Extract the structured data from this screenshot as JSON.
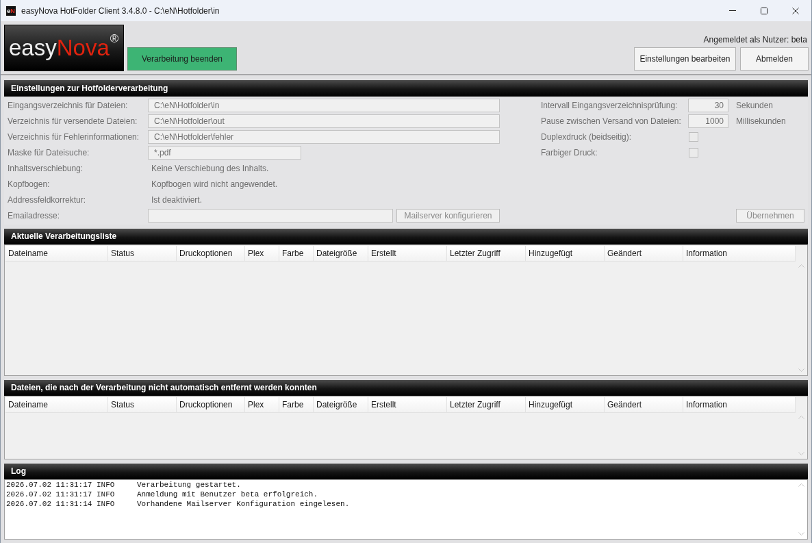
{
  "window": {
    "icon": {
      "first": "e",
      "second": "N"
    },
    "title": "easyNova HotFolder Client 3.4.8.0 - C:\\eN\\Hotfolder\\in"
  },
  "header": {
    "logo": {
      "first": "easy",
      "second": "Nova",
      "mark": "®"
    },
    "primary_button": "Verarbeitung beenden",
    "user_label": "Angemeldet als Nutzer: beta",
    "buttons": [
      "Einstellungen bearbeiten",
      "Abmelden"
    ]
  },
  "settings": {
    "title": "Einstellungen zur Hotfolderverarbeitung",
    "disabled": true,
    "left": [
      {
        "kind": "wide_field",
        "label": "Eingangsverzeichnis für Dateien:",
        "value": "C:\\eN\\Hotfolder\\in"
      },
      {
        "kind": "wide_field",
        "label": "Verzeichnis für versendete Dateien:",
        "value": "C:\\eN\\Hotfolder\\out"
      },
      {
        "kind": "wide_field",
        "label": "Verzeichnis für Fehlerinformationen:",
        "value": "C:\\eN\\Hotfolder\\fehler"
      },
      {
        "kind": "short_field",
        "label": "Maske für Dateisuche:",
        "value": "*.pdf"
      },
      {
        "kind": "text",
        "label": "Inhaltsverschiebung:",
        "value": "Keine Verschiebung des Inhalts."
      },
      {
        "kind": "text",
        "label": "Kopfbogen:",
        "value": "Kopfbogen wird nicht angewendet."
      },
      {
        "kind": "text",
        "label": "Addressfeldkorrektur:",
        "value": "Ist deaktiviert."
      },
      {
        "kind": "field_with_button",
        "label": "Emailadresse:",
        "button": {
          "label": "Mailserver konfigurieren",
          "disabled": true
        }
      }
    ],
    "right": [
      {
        "kind": "number",
        "label": "Intervall Eingangsverzeichnisprüfung:",
        "value": "30",
        "unit": "Sekunden"
      },
      {
        "kind": "number",
        "label": "Pause zwischen Versand von Dateien:",
        "value": "1000",
        "unit": "Millisekunden"
      },
      {
        "kind": "checkbox",
        "label": "Duplexdruck (beidseitig):",
        "checked": false
      },
      {
        "kind": "checkbox",
        "label": "Farbiger Druck:",
        "checked": false
      }
    ],
    "apply_button": {
      "label": "Übernehmen",
      "disabled": true
    }
  },
  "tables": [
    {
      "title": "Aktuelle Verarbeitungsliste",
      "columns": [
        "Dateiname",
        "Status",
        "Druckoptionen",
        "Plex",
        "Farbe",
        "Dateigröße",
        "Erstellt",
        "Letzter Zugriff",
        "Hinzugefügt",
        "Geändert",
        "Information"
      ]
    },
    {
      "title": "Dateien, die nach der Verarbeitung nicht automatisch entfernt werden konnten",
      "columns": [
        "Dateiname",
        "Status",
        "Druckoptionen",
        "Plex",
        "Farbe",
        "Dateigröße",
        "Erstellt",
        "Letzter Zugriff",
        "Hinzugefügt",
        "Geändert",
        "Information"
      ]
    }
  ],
  "log": {
    "title": "Log",
    "entries": [
      {
        "time": "2026.07.02 11:31:17",
        "level": "INFO",
        "message": "Verarbeitung gestartet."
      },
      {
        "time": "2026.07.02 11:31:17",
        "level": "INFO",
        "message": "Anmeldung mit Benutzer beta erfolgreich."
      },
      {
        "time": "2026.07.02 11:31:14",
        "level": "INFO",
        "message": "Vorhandene Mailserver Konfiguration eingelesen."
      }
    ]
  }
}
